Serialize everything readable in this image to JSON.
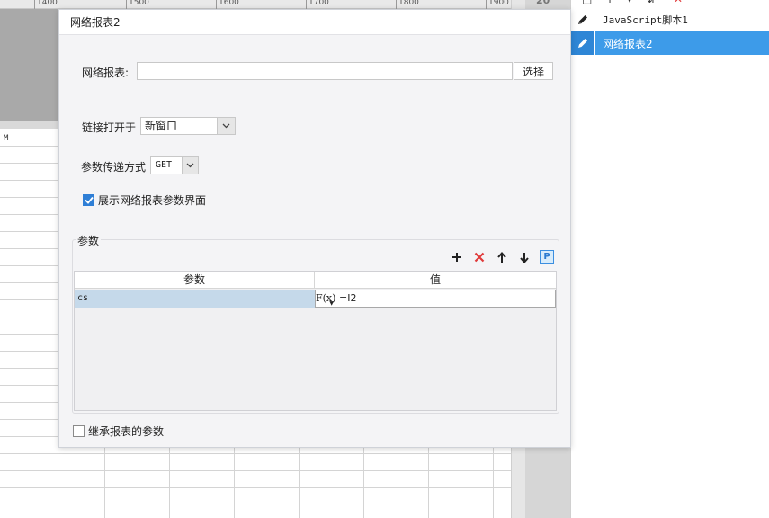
{
  "sheet": {
    "ruler": [
      "1400",
      "1500",
      "1600",
      "1700",
      "1800",
      "1900"
    ],
    "column_header": "M",
    "side_label": "20"
  },
  "right_panel": {
    "items": [
      {
        "label": "JavaScript脚本1",
        "icon": "pencil-icon",
        "selected": false
      },
      {
        "label": "网络报表2",
        "icon": "pencil-icon",
        "selected": true
      }
    ]
  },
  "dialog": {
    "title": "网络报表2",
    "report": {
      "label": "网络报表:",
      "value": "",
      "button": "选择"
    },
    "open_in": {
      "label": "链接打开于",
      "value": "新窗口"
    },
    "method": {
      "label": "参数传递方式",
      "value": "GET"
    },
    "show_param_ui": {
      "label": "展示网络报表参数界面",
      "checked": true
    },
    "params": {
      "title": "参数",
      "tools": [
        "add-icon",
        "delete-icon",
        "move-up-icon",
        "move-down-icon",
        "p-icon"
      ],
      "tool_p_label": "P",
      "columns": [
        "参数",
        "值"
      ],
      "rows": [
        {
          "name": "cs",
          "formula_label": "F(x)",
          "value": "=I2"
        }
      ]
    },
    "inherit": {
      "label": "继承报表的参数",
      "checked": false
    }
  },
  "colors": {
    "selected_item": "#3d9be9",
    "checkbox_checked": "#2f7fd6",
    "delete_red": "#e03a3a",
    "row_highlight": "#c5d9ea"
  }
}
